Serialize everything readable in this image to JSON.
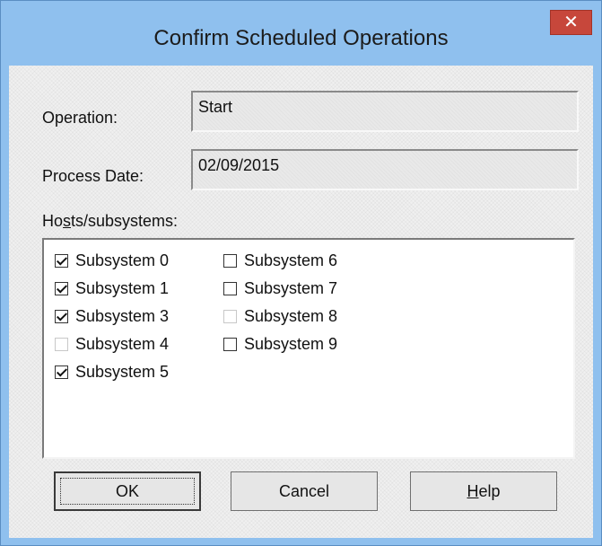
{
  "window": {
    "title": "Confirm Scheduled Operations",
    "close_glyph": "✕"
  },
  "form": {
    "operation_label": "Operation:",
    "operation_value": "Start",
    "process_date_label": "Process Date:",
    "process_date_value": "02/09/2015",
    "hosts_label_pre": "Ho",
    "hosts_label_accel": "s",
    "hosts_label_post": "ts/subsystems:"
  },
  "subsystems": [
    {
      "label": "Subsystem 0",
      "checked": true,
      "enabled": true
    },
    {
      "label": "Subsystem 1",
      "checked": true,
      "enabled": true
    },
    {
      "label": "Subsystem 3",
      "checked": true,
      "enabled": true
    },
    {
      "label": "Subsystem 4",
      "checked": false,
      "enabled": false
    },
    {
      "label": "Subsystem 5",
      "checked": true,
      "enabled": true
    },
    {
      "label": "Subsystem 6",
      "checked": false,
      "enabled": true
    },
    {
      "label": "Subsystem 7",
      "checked": false,
      "enabled": true
    },
    {
      "label": "Subsystem 8",
      "checked": false,
      "enabled": false
    },
    {
      "label": "Subsystem 9",
      "checked": false,
      "enabled": true
    }
  ],
  "buttons": {
    "ok": "OK",
    "cancel": "Cancel",
    "help_accel": "H",
    "help_rest": "elp"
  },
  "colors": {
    "title_bar": "#8fc0ee",
    "close_button": "#c7473b",
    "dialog_face": "#f0f0f0"
  }
}
